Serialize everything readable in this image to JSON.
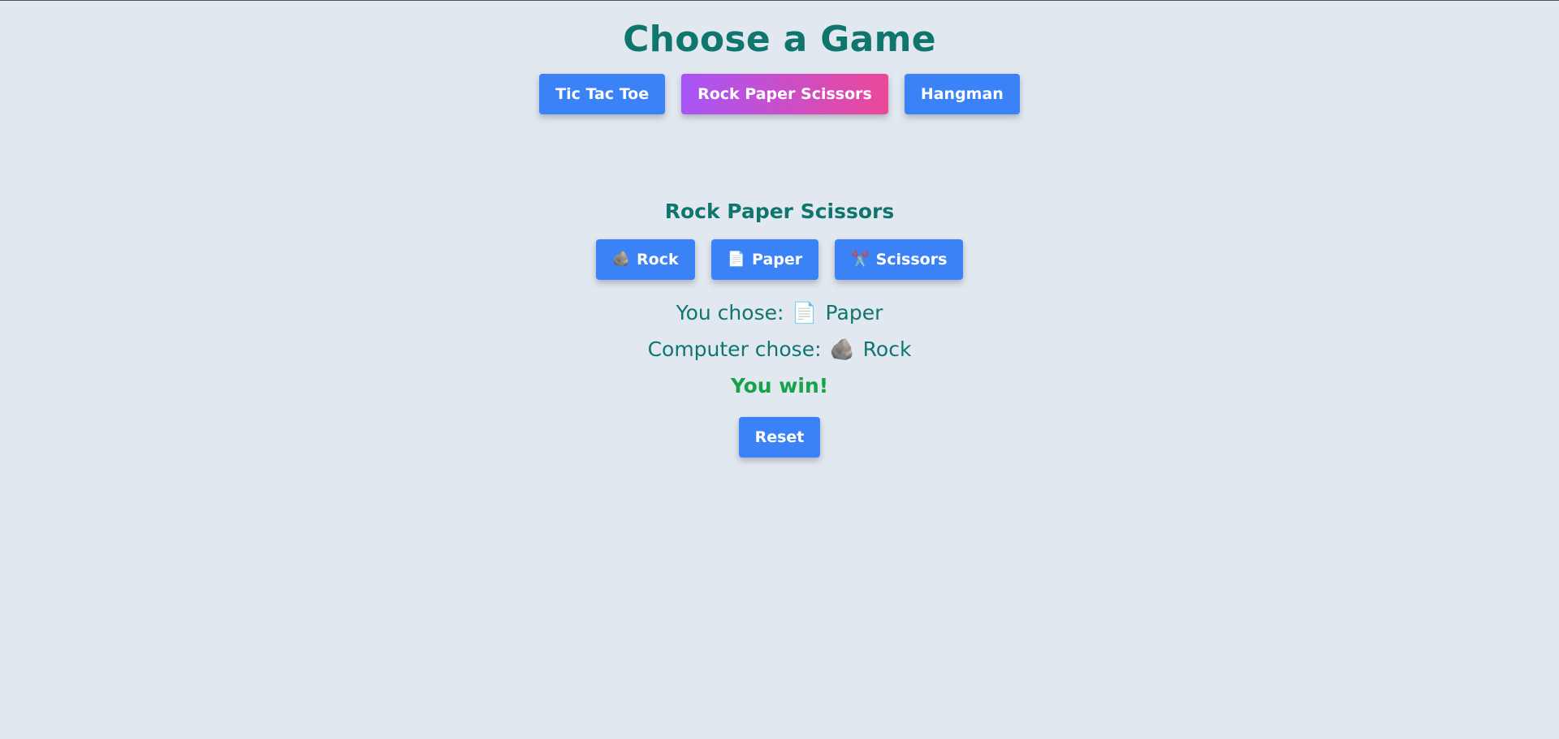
{
  "page": {
    "title": "Choose a Game"
  },
  "nav": {
    "items": [
      {
        "label": "Tic Tac Toe",
        "active": false
      },
      {
        "label": "Rock Paper Scissors",
        "active": true
      },
      {
        "label": "Hangman",
        "active": false
      }
    ]
  },
  "game": {
    "title": "Rock Paper Scissors",
    "choices": [
      {
        "icon": "rock-icon",
        "glyph": "🪨",
        "label": "Rock"
      },
      {
        "icon": "paper-icon",
        "glyph": "📄",
        "label": "Paper"
      },
      {
        "icon": "scissors-icon",
        "glyph": "✂️",
        "label": "Scissors"
      }
    ],
    "player": {
      "prefix": "You chose:",
      "icon": "paper-icon",
      "glyph": "📄",
      "choice": "Paper"
    },
    "computer": {
      "prefix": "Computer chose:",
      "icon": "rock-icon",
      "glyph": "🪨",
      "choice": "Rock"
    },
    "result": "You win!",
    "reset_label": "Reset"
  },
  "colors": {
    "background": "#e2e8f0",
    "heading": "#0f766e",
    "button": "#3b82f6",
    "active_gradient_start": "#a855f7",
    "active_gradient_end": "#ec4899",
    "win": "#16a34a"
  }
}
